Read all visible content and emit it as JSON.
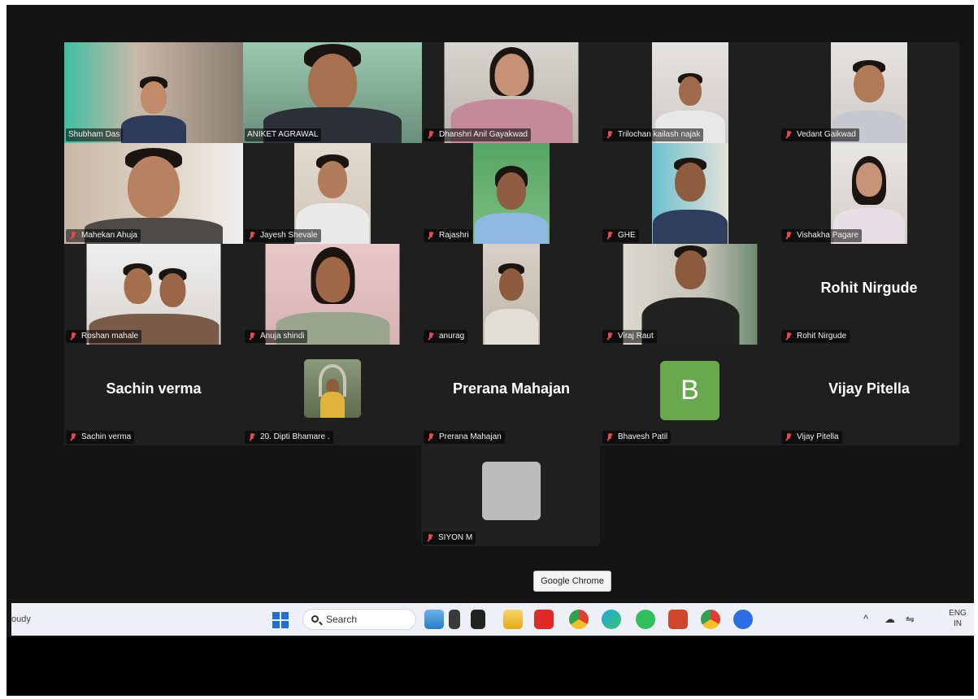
{
  "participants": [
    {
      "name": "Shubham Das",
      "muted": false,
      "speaking": false
    },
    {
      "name": "ANIKET AGRAWAL",
      "muted": false,
      "speaking": true
    },
    {
      "name": "Dhanshri Anil Gayakwad",
      "muted": true
    },
    {
      "name": "Trilochan kailash najak",
      "muted": true
    },
    {
      "name": "Vedant Gaikwad",
      "muted": true
    },
    {
      "name": "Mahekan Ahuja",
      "muted": true
    },
    {
      "name": "Jayesh Shevale",
      "muted": true
    },
    {
      "name": "Rajashri",
      "muted": true
    },
    {
      "name": "GHE",
      "muted": true
    },
    {
      "name": "Vishakha Pagare",
      "muted": true
    },
    {
      "name": "Roshan mahale",
      "muted": true
    },
    {
      "name": "Anuja shindi",
      "muted": true
    },
    {
      "name": "anurag",
      "muted": true
    },
    {
      "name": "Viraj Raut",
      "muted": true
    },
    {
      "name": "Rohit Nirgude",
      "display": "Rohit Nirgude",
      "muted": true
    },
    {
      "name": "Sachin verma",
      "display": "Sachin verma",
      "muted": true
    },
    {
      "name": "20. Dipti Bhamare .",
      "muted": true
    },
    {
      "name": "Prerana Mahajan",
      "display": "Prerana Mahajan",
      "muted": true
    },
    {
      "name": "Bhavesh Patil",
      "avatar_letter": "B",
      "avatar_color": "#6aa84f",
      "muted": true
    },
    {
      "name": "Vijay Pitella",
      "display": "Vijay Pitella",
      "muted": true
    },
    {
      "name": "SIYON M",
      "muted": true
    }
  ],
  "tooltip": "Google Chrome",
  "taskbar": {
    "weather": "oudy",
    "search_placeholder": "Search",
    "apps": [
      "file-explorer",
      "news",
      "task-view",
      "folder",
      "youtube",
      "chrome",
      "edge",
      "whatsapp",
      "powerpoint",
      "chrome-profile",
      "zoom"
    ],
    "tray": {
      "lang_top": "ENG",
      "lang_bottom": "IN"
    }
  },
  "colors": {
    "speaking_border": "#3ddc84",
    "muted_icon": "#e5484d",
    "stage_bg": "#202020"
  }
}
